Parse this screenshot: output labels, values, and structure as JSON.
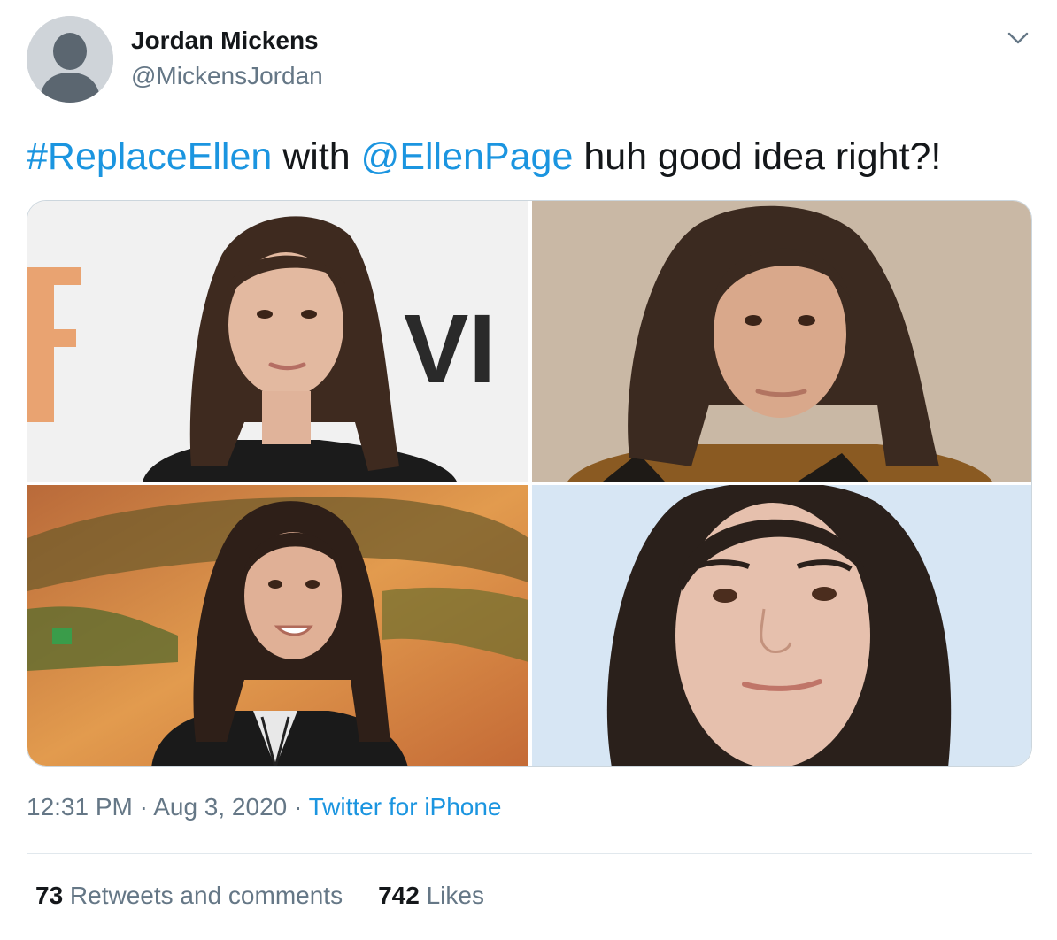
{
  "author": {
    "name": "Jordan Mickens",
    "handle": "@MickensJordan"
  },
  "tweet": {
    "hashtag": "#ReplaceEllen",
    "text_1": " with ",
    "mention": "@EllenPage",
    "text_2": " huh good idea right?!"
  },
  "meta": {
    "time": "12:31 PM",
    "sep1": " · ",
    "date": "Aug 3, 2020",
    "sep2": " · ",
    "source": "Twitter for iPhone"
  },
  "stats": {
    "retweets_count": "73",
    "retweets_label": " Retweets and comments",
    "likes_count": "742",
    "likes_label": " Likes"
  },
  "media": {
    "photo_count": 4,
    "photo_1_backdrop_text": "VI"
  },
  "colors": {
    "link": "#1b95e0",
    "secondary": "#657786",
    "primary_text": "#14171a"
  }
}
